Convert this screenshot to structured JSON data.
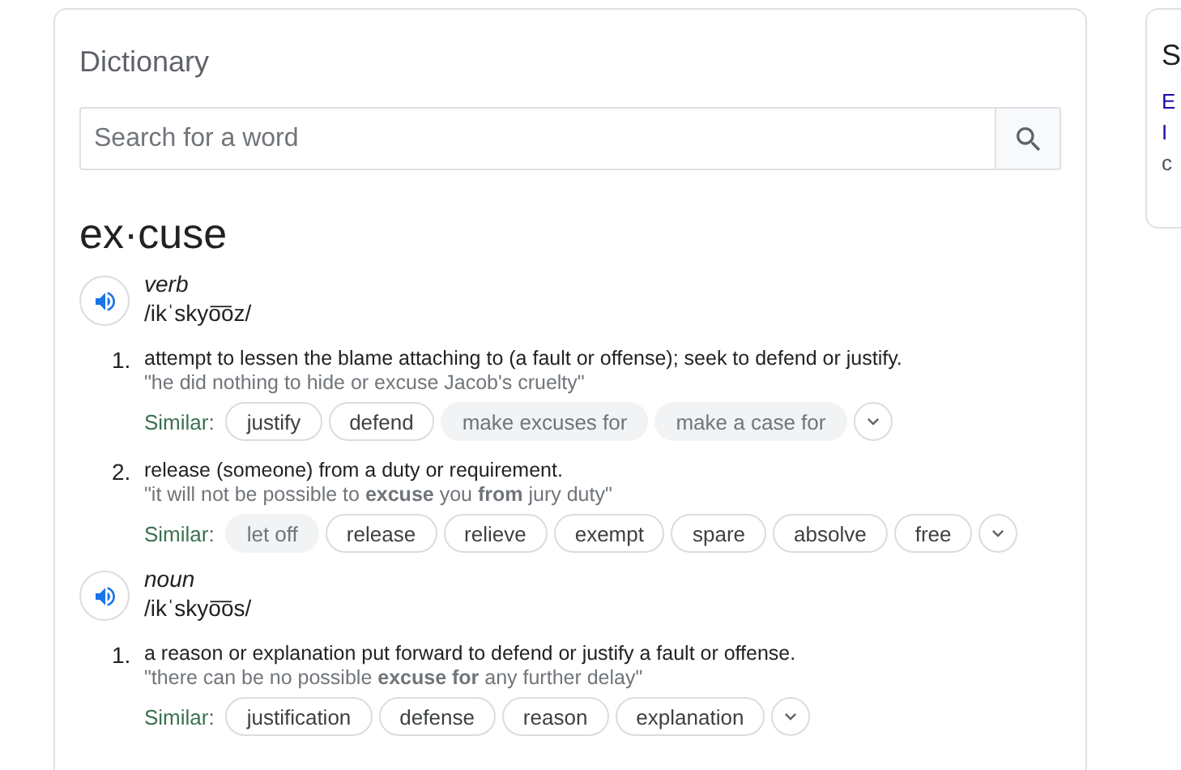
{
  "dictionary": {
    "title": "Dictionary",
    "search": {
      "placeholder": "Search for a word"
    },
    "headword": "ex·cuse",
    "entries": [
      {
        "part_of_speech": "verb",
        "pronunciation": "/ikˈskyo͞oz/",
        "senses": [
          {
            "number": "1.",
            "definition": "attempt to lessen the blame attaching to (a fault or offense); seek to defend or justify.",
            "example": "\"he did nothing to hide or excuse Jacob's cruelty\"",
            "similar_label": "Similar:",
            "similar": [
              {
                "word": "justify",
                "linked": true
              },
              {
                "word": "defend",
                "linked": true
              },
              {
                "word": "make excuses for",
                "linked": false
              },
              {
                "word": "make a case for",
                "linked": false
              }
            ]
          },
          {
            "number": "2.",
            "definition": "release (someone) from a duty or requirement.",
            "example": "\"it will not be possible to **excuse** you **from** jury duty\"",
            "similar_label": "Similar:",
            "similar": [
              {
                "word": "let off",
                "linked": false
              },
              {
                "word": "release",
                "linked": true
              },
              {
                "word": "relieve",
                "linked": true
              },
              {
                "word": "exempt",
                "linked": true
              },
              {
                "word": "spare",
                "linked": true
              },
              {
                "word": "absolve",
                "linked": true
              },
              {
                "word": "free",
                "linked": true
              }
            ]
          }
        ]
      },
      {
        "part_of_speech": "noun",
        "pronunciation": "/ikˈskyo͞os/",
        "senses": [
          {
            "number": "1.",
            "definition": "a reason or explanation put forward to defend or justify a fault or offense.",
            "example": "\"there can be no possible **excuse for** any further delay\"",
            "similar_label": "Similar:",
            "similar": [
              {
                "word": "justification",
                "linked": true
              },
              {
                "word": "defense",
                "linked": true
              },
              {
                "word": "reason",
                "linked": true
              },
              {
                "word": "explanation",
                "linked": true
              }
            ]
          }
        ]
      }
    ]
  },
  "side_card": {
    "title": "S",
    "lines": [
      "E",
      "I",
      "c"
    ]
  }
}
